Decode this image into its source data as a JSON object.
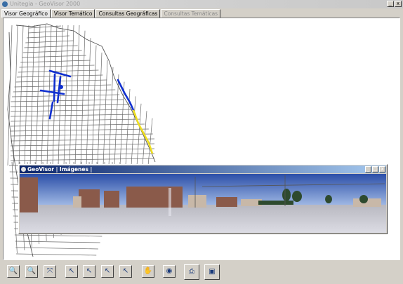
{
  "window": {
    "title": "Unitegia - GeoVisor 2000",
    "minimize_label": "_",
    "maximize_label": "□",
    "close_label": "x"
  },
  "tabs": [
    {
      "label": "Visor Geográfico",
      "active": true,
      "enabled": true
    },
    {
      "label": "Visor Temático",
      "active": false,
      "enabled": true
    },
    {
      "label": "Consultas Geográficas",
      "active": false,
      "enabled": true
    },
    {
      "label": "Consultas Temáticas",
      "active": false,
      "enabled": false
    }
  ],
  "image_viewer": {
    "title": "GeoVisor | Imágenes |",
    "minimize_label": "_",
    "maximize_label": "□",
    "close_label": "x"
  },
  "map": {
    "route_color": "#1030d0",
    "selected_segment_color": "#f0e020",
    "street_color": "#6a6a6a"
  },
  "toolbar": {
    "buttons": [
      {
        "name": "zoom-in-button",
        "icon": "zoom-in-icon",
        "glyph": "🔍"
      },
      {
        "name": "zoom-out-button",
        "icon": "zoom-out-icon",
        "glyph": "🔍"
      },
      {
        "name": "zoom-window-button",
        "icon": "zoom-window-icon",
        "glyph": "⤧"
      },
      {
        "name": "select-point-button",
        "icon": "select-pointer-icon",
        "glyph": "↖"
      },
      {
        "name": "select-area-button",
        "icon": "select-area-icon",
        "glyph": "↖"
      },
      {
        "name": "select-street-button",
        "icon": "select-street-icon",
        "glyph": "↖"
      },
      {
        "name": "identify-button",
        "icon": "identify-pointer-icon",
        "glyph": "↖"
      },
      {
        "name": "pan-button",
        "icon": "hand-icon",
        "glyph": "✋"
      },
      {
        "name": "globe-button",
        "icon": "globe-icon",
        "glyph": "◉"
      },
      {
        "name": "print-button",
        "icon": "printer-icon",
        "glyph": "⎙"
      },
      {
        "name": "photo-button",
        "icon": "camera-icon",
        "glyph": "▣"
      }
    ]
  }
}
